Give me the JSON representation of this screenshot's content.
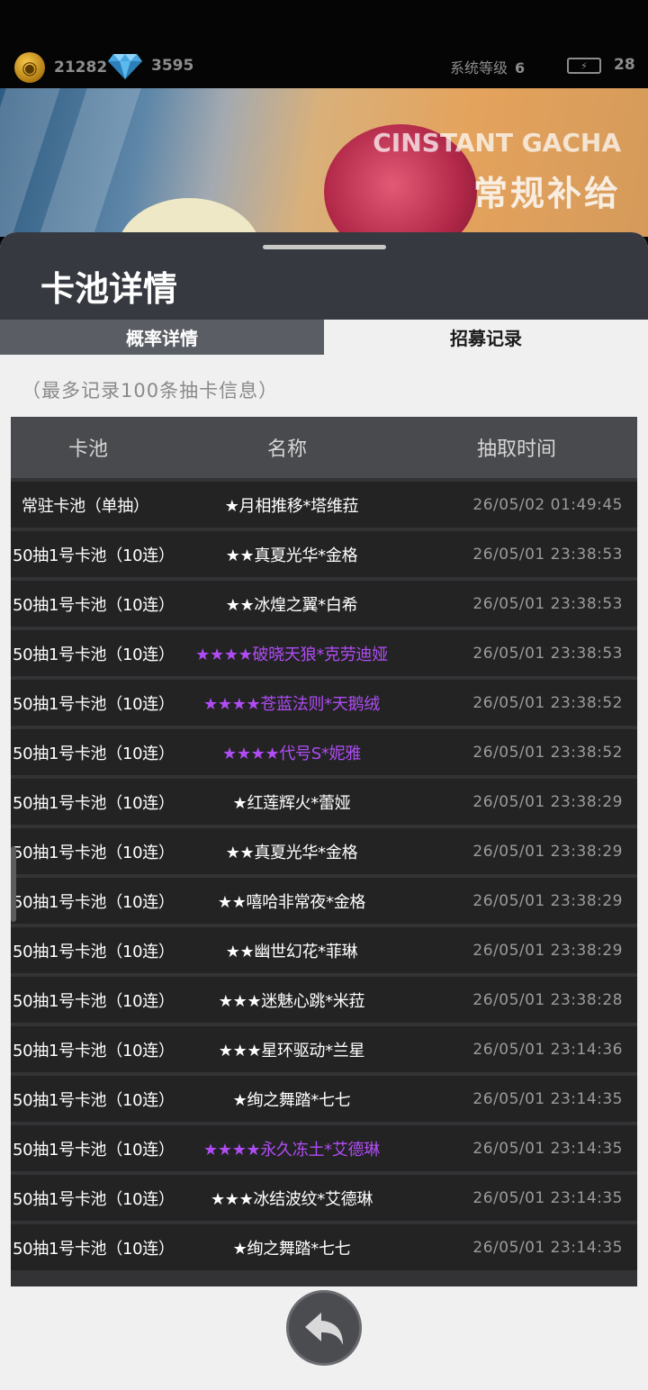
{
  "status": {
    "coins": "21282",
    "gems": "3595",
    "system_level_label": "系统等级",
    "system_level_value": "6",
    "energy": "28"
  },
  "banner": {
    "title_en": "CINSTANT GACHA",
    "title_cn": "常规补给"
  },
  "sheet": {
    "title": "卡池详情",
    "tabs": [
      {
        "label": "概率详情",
        "active": false
      },
      {
        "label": "招募记录",
        "active": true
      }
    ],
    "note": "（最多记录100条抽卡信息）"
  },
  "table": {
    "headers": {
      "pool": "卡池",
      "name": "名称",
      "time": "抽取时间"
    },
    "rows": [
      {
        "pool": "常驻卡池（单抽）",
        "name": "★月相推移*塔维菈",
        "time": "26/05/02 01:49:45",
        "rarity": "normal"
      },
      {
        "pool": "50抽1号卡池（10连）",
        "name": "★★真夏光华*金格",
        "time": "26/05/01 23:38:53",
        "rarity": "normal"
      },
      {
        "pool": "50抽1号卡池（10连）",
        "name": "★★冰煌之翼*白希",
        "time": "26/05/01 23:38:53",
        "rarity": "normal"
      },
      {
        "pool": "50抽1号卡池（10连）",
        "name": "★★★★破晓天狼*克劳迪娅",
        "time": "26/05/01 23:38:53",
        "rarity": "purple"
      },
      {
        "pool": "50抽1号卡池（10连）",
        "name": "★★★★苍蓝法则*天鹅绒",
        "time": "26/05/01 23:38:52",
        "rarity": "purple"
      },
      {
        "pool": "50抽1号卡池（10连）",
        "name": "★★★★代号S*妮雅",
        "time": "26/05/01 23:38:52",
        "rarity": "purple"
      },
      {
        "pool": "50抽1号卡池（10连）",
        "name": "★红莲辉火*蕾娅",
        "time": "26/05/01 23:38:29",
        "rarity": "normal"
      },
      {
        "pool": "50抽1号卡池（10连）",
        "name": "★★真夏光华*金格",
        "time": "26/05/01 23:38:29",
        "rarity": "normal"
      },
      {
        "pool": "50抽1号卡池（10连）",
        "name": "★★嘻哈非常夜*金格",
        "time": "26/05/01 23:38:29",
        "rarity": "normal"
      },
      {
        "pool": "50抽1号卡池（10连）",
        "name": "★★幽世幻花*菲琳",
        "time": "26/05/01 23:38:29",
        "rarity": "normal"
      },
      {
        "pool": "50抽1号卡池（10连）",
        "name": "★★★迷魅心跳*米菈",
        "time": "26/05/01 23:38:28",
        "rarity": "normal"
      },
      {
        "pool": "50抽1号卡池（10连）",
        "name": "★★★星环驱动*兰星",
        "time": "26/05/01 23:14:36",
        "rarity": "normal"
      },
      {
        "pool": "50抽1号卡池（10连）",
        "name": "★绚之舞踏*七七",
        "time": "26/05/01 23:14:35",
        "rarity": "normal"
      },
      {
        "pool": "50抽1号卡池（10连）",
        "name": "★★★★永久冻土*艾德琳",
        "time": "26/05/01 23:14:35",
        "rarity": "purple"
      },
      {
        "pool": "50抽1号卡池（10连）",
        "name": "★★★冰结波纹*艾德琳",
        "time": "26/05/01 23:14:35",
        "rarity": "normal"
      },
      {
        "pool": "50抽1号卡池（10连）",
        "name": "★绚之舞踏*七七",
        "time": "26/05/01 23:14:35",
        "rarity": "normal"
      }
    ]
  },
  "colors": {
    "purple_rarity": "#b04cf4",
    "sheet_header": "#363a40",
    "row_bg": "#232324"
  },
  "icons": {
    "coin": "coin-icon",
    "gem": "diamond-icon",
    "battery": "battery-icon",
    "back": "back-arrow-icon"
  }
}
